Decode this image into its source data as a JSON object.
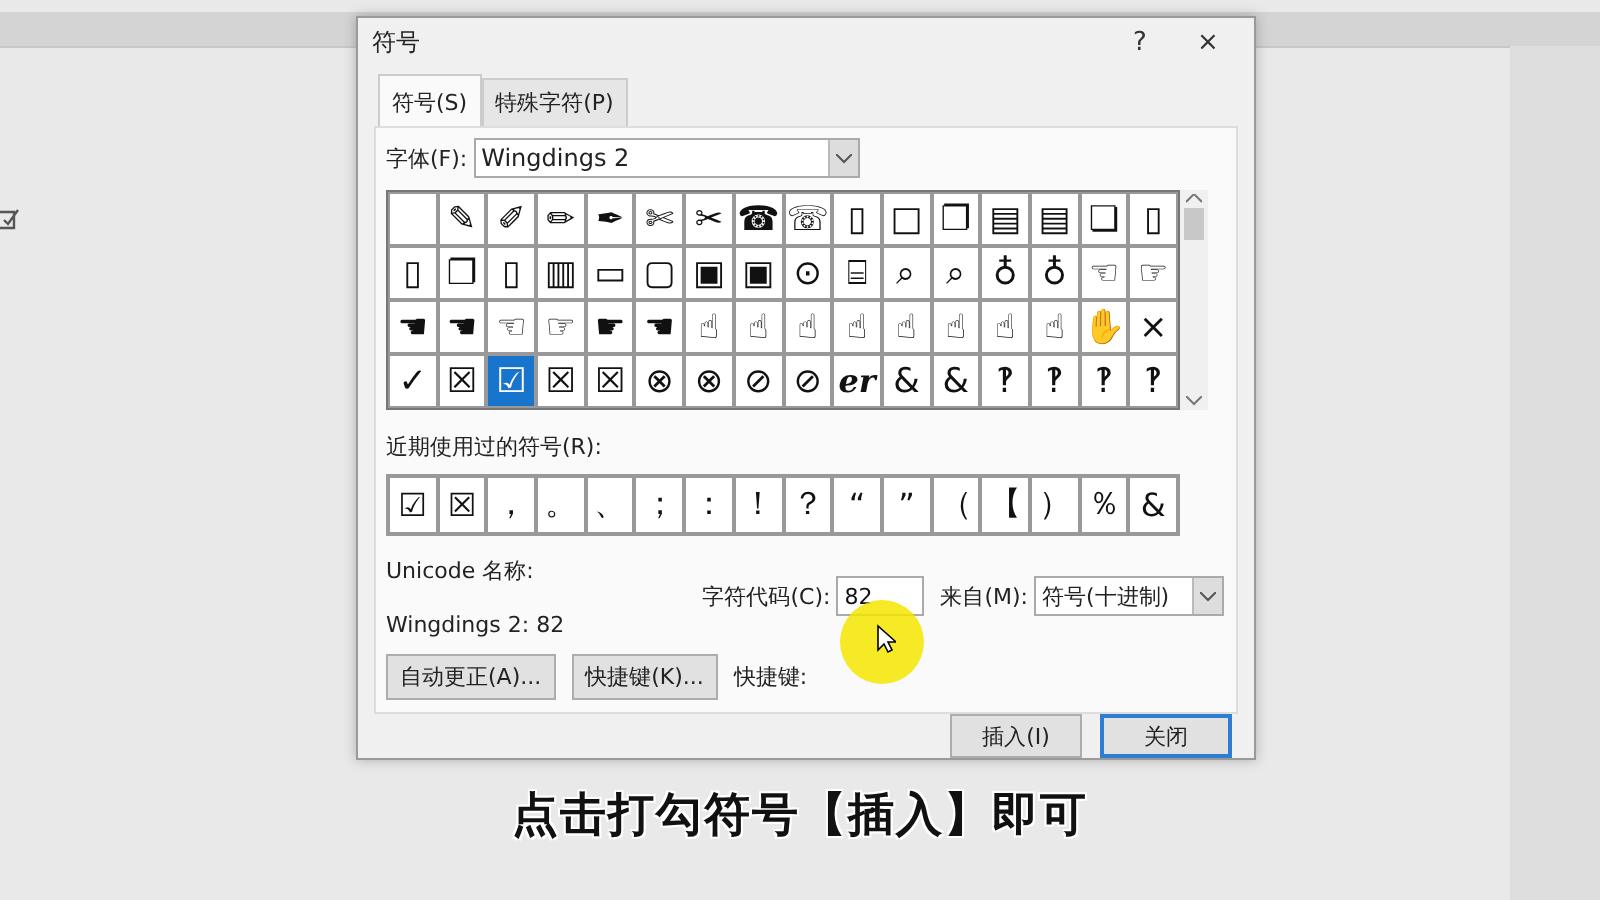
{
  "dialog": {
    "title": "符号",
    "help": "?",
    "close": "×",
    "tabs": [
      {
        "label": "符号(S)",
        "selected": true
      },
      {
        "label": "特殊字符(P)",
        "selected": false
      }
    ],
    "font": {
      "label": "字体(F):",
      "value": "Wingdings 2"
    },
    "symbols": [
      [
        {
          "selected": false
        },
        {
          "glyph": "✎",
          "selected": false
        },
        {
          "glyph": "✐",
          "selected": false
        },
        {
          "glyph": "✏",
          "selected": false
        },
        {
          "glyph": "✒",
          "selected": false
        },
        {
          "glyph": "✄",
          "selected": false
        },
        {
          "glyph": "✂",
          "selected": false
        },
        {
          "glyph": "☎",
          "selected": false
        },
        {
          "glyph": "☏",
          "selected": false
        },
        {
          "glyph": "▯",
          "selected": false
        },
        {
          "glyph": "□",
          "selected": false
        },
        {
          "glyph": "❐",
          "selected": false
        },
        {
          "glyph": "▤",
          "selected": false
        },
        {
          "glyph": "▤",
          "selected": false
        },
        {
          "glyph": "❏",
          "selected": false
        },
        {
          "glyph": "▯",
          "selected": false
        }
      ],
      [
        {
          "glyph": "▯",
          "selected": false
        },
        {
          "glyph": "❐",
          "selected": false
        },
        {
          "glyph": "▯",
          "selected": false
        },
        {
          "glyph": "▥",
          "selected": false
        },
        {
          "glyph": "▭",
          "selected": false
        },
        {
          "glyph": "▢",
          "selected": false
        },
        {
          "glyph": "▣",
          "selected": false
        },
        {
          "glyph": "▣",
          "selected": false
        },
        {
          "glyph": "⊙",
          "selected": false
        },
        {
          "glyph": "⌸",
          "selected": false
        },
        {
          "glyph": "⌕",
          "selected": false
        },
        {
          "glyph": "⌕",
          "selected": false
        },
        {
          "glyph": "♁",
          "selected": false
        },
        {
          "glyph": "♁",
          "selected": false
        },
        {
          "glyph": "☜",
          "selected": false
        },
        {
          "glyph": "☞",
          "selected": false
        }
      ],
      [
        {
          "glyph": "☚",
          "selected": false
        },
        {
          "glyph": "☚",
          "selected": false
        },
        {
          "glyph": "☜",
          "selected": false
        },
        {
          "glyph": "☞",
          "selected": false
        },
        {
          "glyph": "☛",
          "selected": false
        },
        {
          "glyph": "☚",
          "selected": false
        },
        {
          "glyph": "☝",
          "selected": false
        },
        {
          "glyph": "☝",
          "selected": false
        },
        {
          "glyph": "☝",
          "selected": false
        },
        {
          "glyph": "☝",
          "selected": false
        },
        {
          "glyph": "☝",
          "selected": false
        },
        {
          "glyph": "☝",
          "selected": false
        },
        {
          "glyph": "☝",
          "selected": false
        },
        {
          "glyph": "☝",
          "selected": false
        },
        {
          "glyph": "✋",
          "selected": false
        },
        {
          "glyph": "×",
          "selected": false
        }
      ],
      [
        {
          "glyph": "✓",
          "selected": false
        },
        {
          "glyph": "☒",
          "selected": false
        },
        {
          "glyph": "☑",
          "selected": true
        },
        {
          "glyph": "☒",
          "selected": false
        },
        {
          "glyph": "☒",
          "selected": false
        },
        {
          "glyph": "⊗",
          "selected": false
        },
        {
          "glyph": "⊗",
          "selected": false
        },
        {
          "glyph": "⊘",
          "selected": false
        },
        {
          "glyph": "⊘",
          "selected": false
        },
        {
          "glyph": "er",
          "selected": false
        },
        {
          "glyph": "&",
          "selected": false
        },
        {
          "glyph": "&",
          "selected": false
        },
        {
          "glyph": "‽",
          "selected": false
        },
        {
          "glyph": "‽",
          "selected": false
        },
        {
          "glyph": "‽",
          "selected": false
        },
        {
          "glyph": "‽",
          "selected": false
        }
      ]
    ],
    "recent_label": "近期使用过的符号(R):",
    "recent": [
      "☑",
      "☒",
      "，",
      "。",
      "、",
      "；",
      "：",
      "！",
      "？",
      "“",
      "”",
      "（",
      "【",
      "）",
      "％",
      "&"
    ],
    "unicode_label": "Unicode 名称:",
    "unicode_value": "Wingdings 2: 82",
    "char_code": {
      "label": "字符代码(C):",
      "value": "82"
    },
    "from": {
      "label": "来自(M):",
      "value": "符号(十进制)"
    },
    "autocorrect_button": "自动更正(A)...",
    "shortcut_button": "快捷键(K)...",
    "shortcut_label": "快捷键:",
    "insert_button": "插入(I)",
    "close_button": "关闭"
  },
  "caption": "点击打勾符号【插入】即可"
}
